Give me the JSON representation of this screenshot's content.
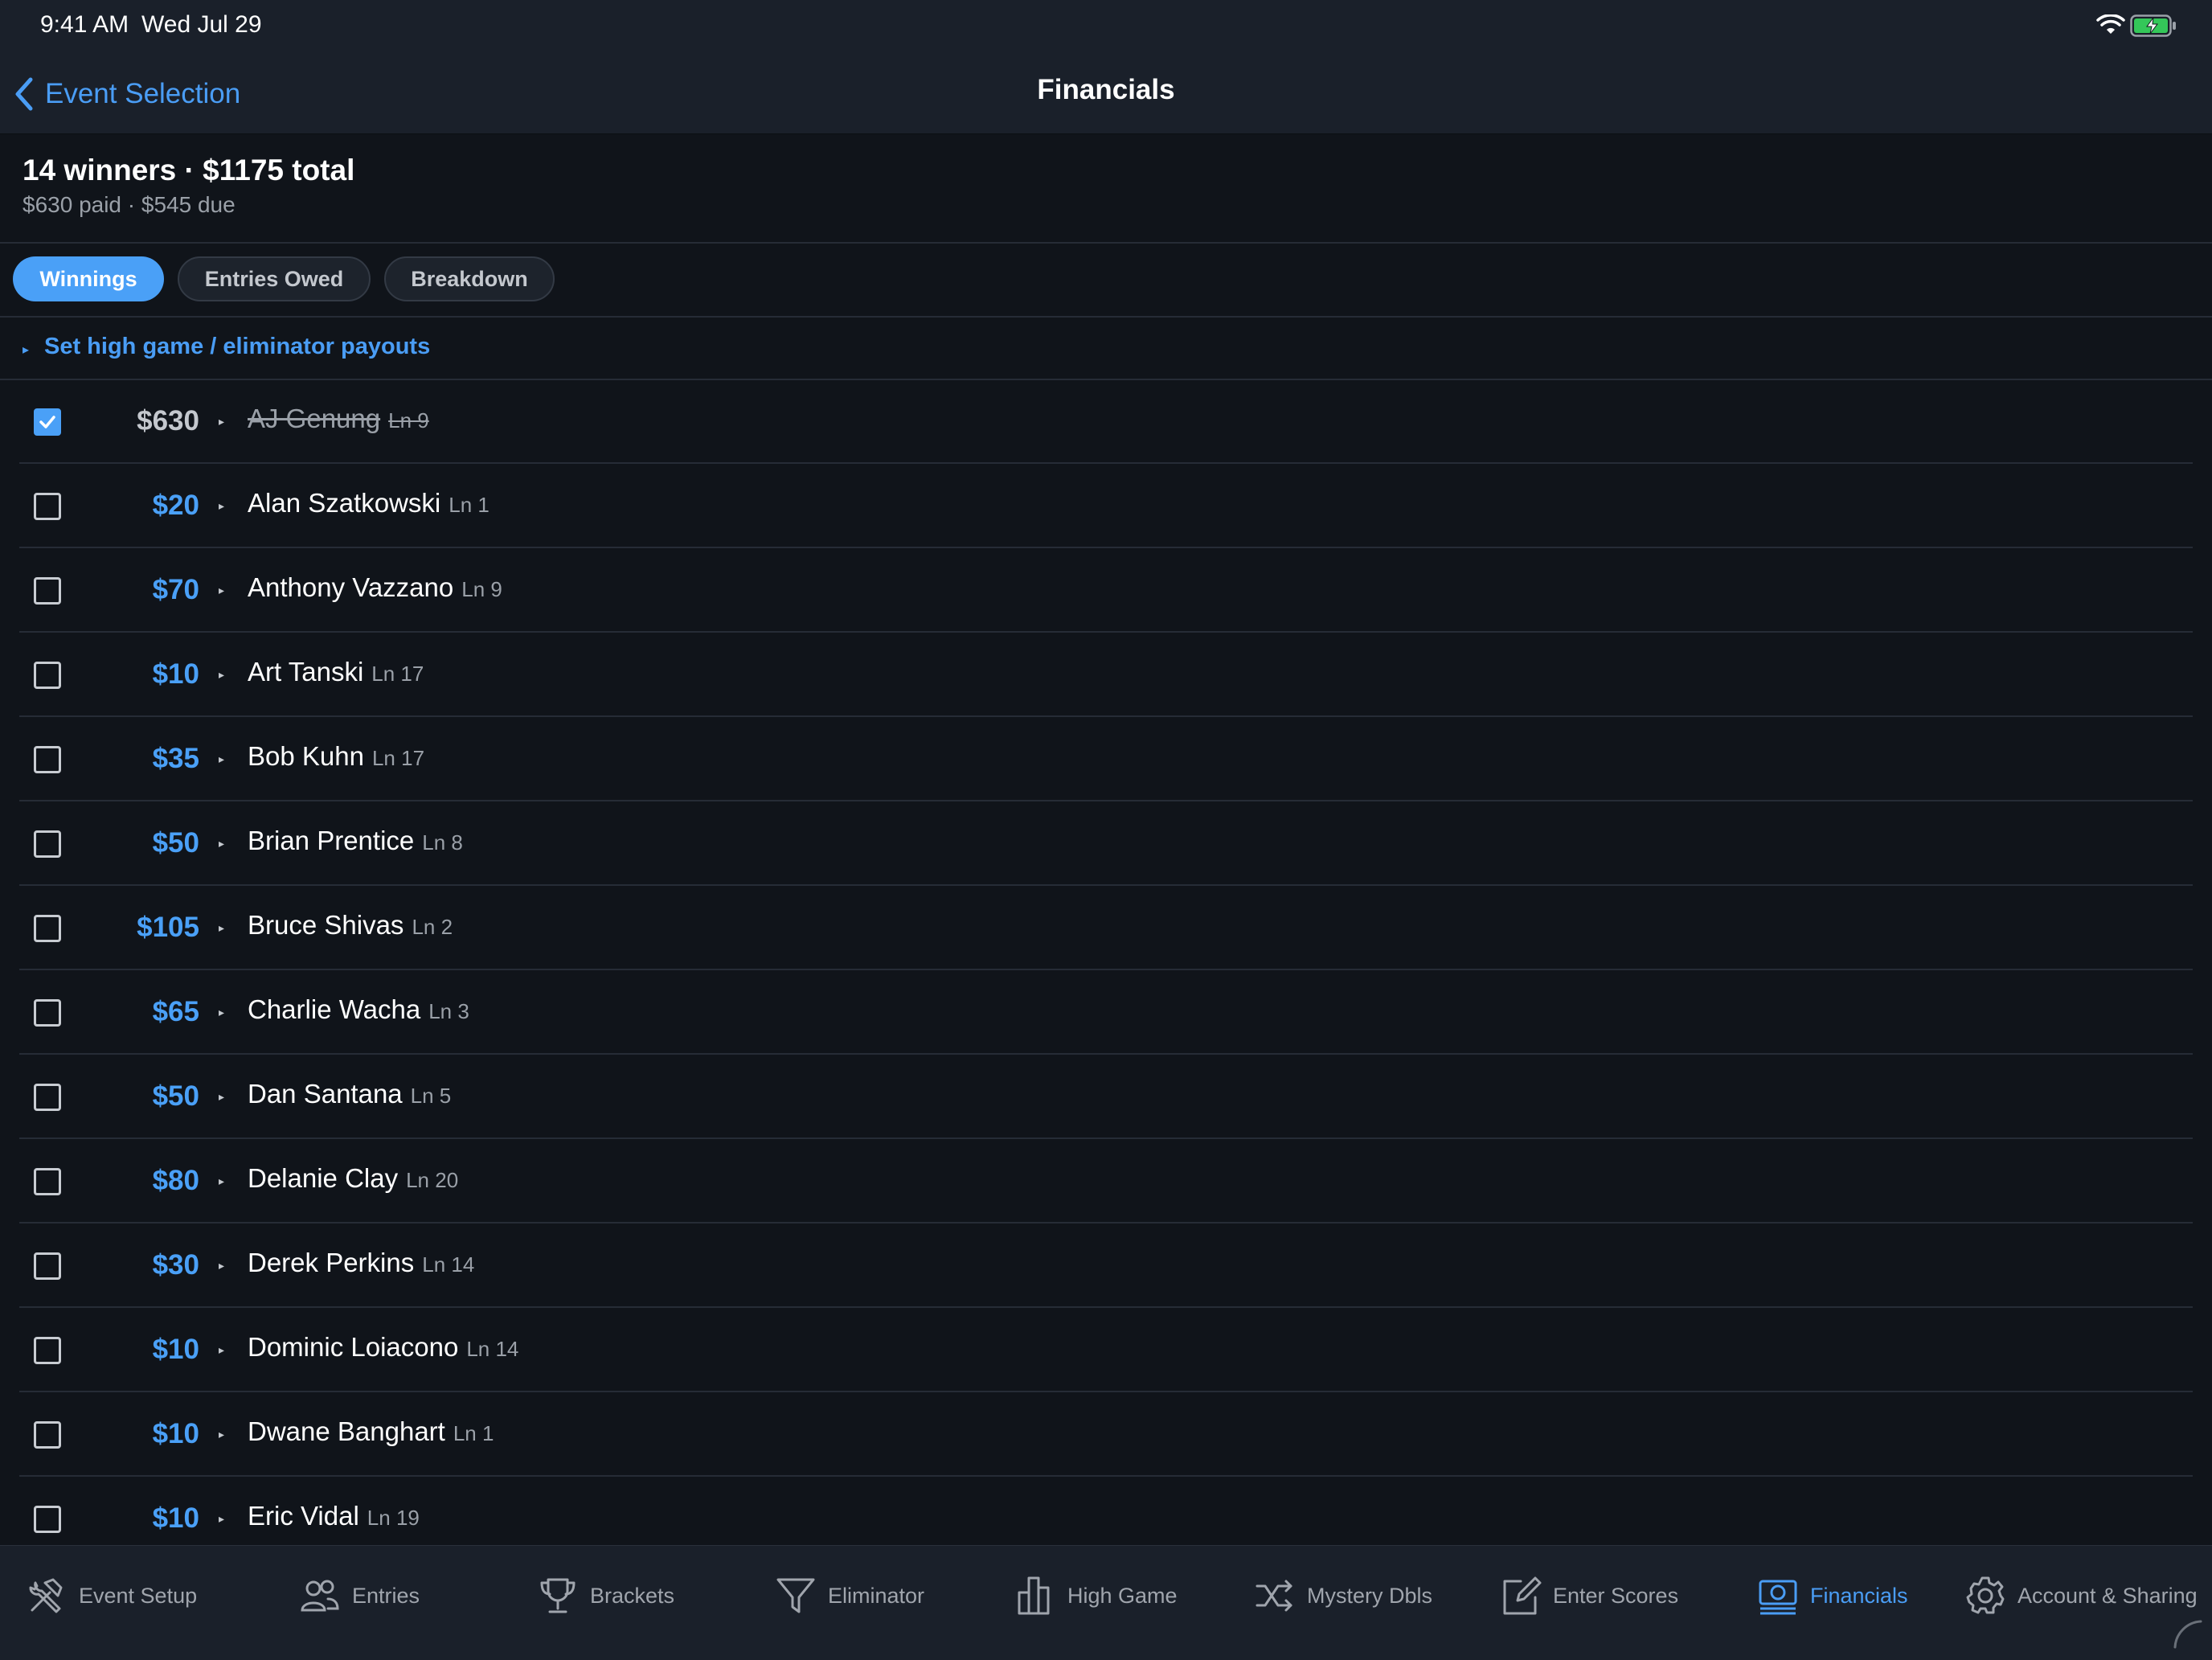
{
  "status_bar": {
    "time": "9:41 AM",
    "date": "Wed Jul 29"
  },
  "nav": {
    "back_label": "Event Selection",
    "title": "Financials"
  },
  "summary": {
    "headline": "14 winners · $1175 total",
    "sub": "$630 paid · $545 due"
  },
  "segments": {
    "winnings": "Winnings",
    "entries_owed": "Entries Owed",
    "breakdown": "Breakdown",
    "selected": "Winnings"
  },
  "payout_toggle": {
    "label": "Set high game / eliminator payouts"
  },
  "winners": [
    {
      "amount": "$630",
      "name": "AJ Genung",
      "lane": "Ln 9",
      "paid": true
    },
    {
      "amount": "$20",
      "name": "Alan Szatkowski",
      "lane": "Ln 1",
      "paid": false
    },
    {
      "amount": "$70",
      "name": "Anthony Vazzano",
      "lane": "Ln 9",
      "paid": false
    },
    {
      "amount": "$10",
      "name": "Art Tanski",
      "lane": "Ln 17",
      "paid": false
    },
    {
      "amount": "$35",
      "name": "Bob Kuhn",
      "lane": "Ln 17",
      "paid": false
    },
    {
      "amount": "$50",
      "name": "Brian Prentice",
      "lane": "Ln 8",
      "paid": false
    },
    {
      "amount": "$105",
      "name": "Bruce Shivas",
      "lane": "Ln 2",
      "paid": false
    },
    {
      "amount": "$65",
      "name": "Charlie Wacha",
      "lane": "Ln 3",
      "paid": false
    },
    {
      "amount": "$50",
      "name": "Dan Santana",
      "lane": "Ln 5",
      "paid": false
    },
    {
      "amount": "$80",
      "name": "Delanie Clay",
      "lane": "Ln 20",
      "paid": false
    },
    {
      "amount": "$30",
      "name": "Derek Perkins",
      "lane": "Ln 14",
      "paid": false
    },
    {
      "amount": "$10",
      "name": "Dominic Loiacono",
      "lane": "Ln 14",
      "paid": false
    },
    {
      "amount": "$10",
      "name": "Dwane Banghart",
      "lane": "Ln 1",
      "paid": false
    },
    {
      "amount": "$10",
      "name": "Eric Vidal",
      "lane": "Ln 19",
      "paid": false
    }
  ],
  "tabs": [
    {
      "label": "Event Setup",
      "icon": "hammer-wrench-icon"
    },
    {
      "label": "Entries",
      "icon": "people-icon"
    },
    {
      "label": "Brackets",
      "icon": "trophy-icon"
    },
    {
      "label": "Eliminator",
      "icon": "funnel-icon"
    },
    {
      "label": "High Game",
      "icon": "bar-chart-icon"
    },
    {
      "label": "Mystery Dbls",
      "icon": "shuffle-icon"
    },
    {
      "label": "Enter Scores",
      "icon": "edit-icon"
    },
    {
      "label": "Financials",
      "icon": "money-icon",
      "active": true
    },
    {
      "label": "Account & Sharing",
      "icon": "gear-icon"
    }
  ],
  "colors": {
    "accent": "#4aa0f7",
    "background": "#10141a",
    "bar": "#1a202a"
  }
}
